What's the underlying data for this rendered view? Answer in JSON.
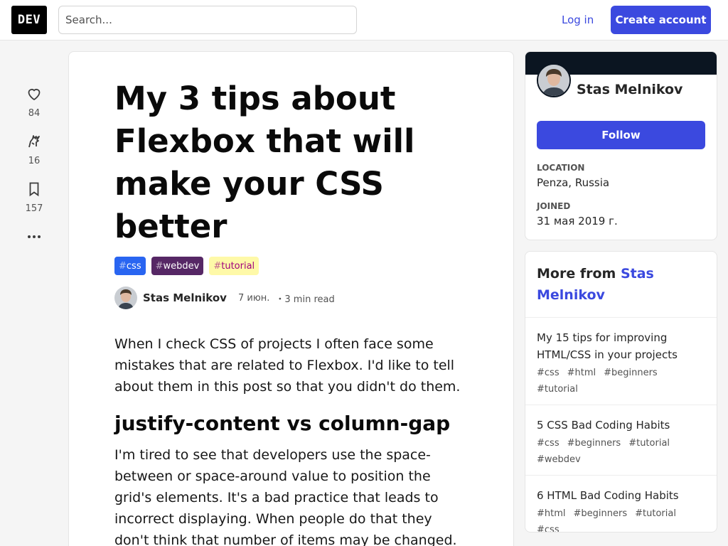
{
  "header": {
    "logo_text": "DEV",
    "search_placeholder": "Search...",
    "login_label": "Log in",
    "create_account_label": "Create account",
    "accent_color": "#3b49df"
  },
  "reactions": {
    "hearts": "84",
    "unicorns": "16",
    "saves": "157",
    "more_icon": "ellipsis-icon"
  },
  "article": {
    "title": "My 3 tips about Flexbox that will make your CSS better",
    "tags": [
      {
        "hash": "#",
        "name": "css",
        "bg": "#2965f1",
        "fg": "#ffffff"
      },
      {
        "hash": "#",
        "name": "webdev",
        "bg": "#562765",
        "fg": "#ffffff"
      },
      {
        "hash": "#",
        "name": "tutorial",
        "bg": "#fef9a8",
        "fg": "#a0007c"
      }
    ],
    "author": "Stas Melnikov",
    "date": "7 июн.",
    "read_time": "・3 min read",
    "intro": "When I check CSS of projects I often face some mistakes that are related to Flexbox. I'd like to tell about them in this post so that you didn't do them.",
    "heading": "justify-content vs column-gap",
    "paragraph": "I'm tired to see that developers use the space-between or space-around value to position the grid's elements. It's a bad practice that leads to incorrect displaying. When people do that they don't think that number of items may be changed."
  },
  "profile": {
    "name": "Stas Melnikov",
    "follow_label": "Follow",
    "location_label": "Location",
    "location": "Penza, Russia",
    "joined_label": "Joined",
    "joined": "31 мая 2019 г."
  },
  "more_from": {
    "prefix": "More from ",
    "author": "Stas Melnikov",
    "items": [
      {
        "title": "My 15 tips for improving HTML/CSS in your projects",
        "tags": [
          "#css",
          "#html",
          "#beginners",
          "#tutorial"
        ]
      },
      {
        "title": "5 CSS Bad Coding Habits",
        "tags": [
          "#css",
          "#beginners",
          "#tutorial",
          "#webdev"
        ]
      },
      {
        "title": "6 HTML Bad Coding Habits",
        "tags": [
          "#html",
          "#beginners",
          "#tutorial",
          "#css"
        ]
      }
    ]
  }
}
